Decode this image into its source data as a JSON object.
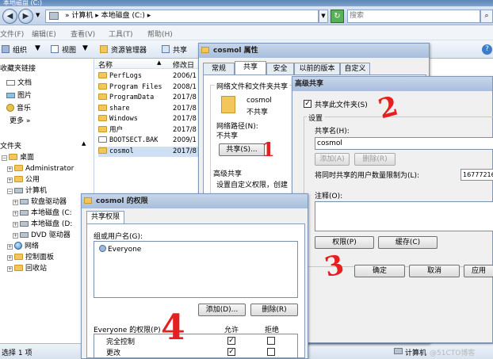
{
  "window": {
    "title": "本地磁盘 (C:)",
    "address_path": [
      "计算机",
      "本地磁盘 (C:)"
    ],
    "search_placeholder": "搜索"
  },
  "menu": [
    "文件(F)",
    "编辑(E)",
    "查看(V)",
    "工具(T)",
    "帮助(H)"
  ],
  "toolbar": {
    "organize": "组织",
    "views": "视图",
    "explorer": "资源管理器",
    "share": "共享"
  },
  "nav_pane": {
    "favorites_header": "收藏夹链接",
    "favorites": [
      "文档",
      "图片",
      "音乐",
      "更多 »"
    ],
    "folders_header": "文件夹",
    "tree": [
      {
        "label": "桌面",
        "indent": 0
      },
      {
        "label": "Administrator",
        "indent": 1
      },
      {
        "label": "公用",
        "indent": 1
      },
      {
        "label": "计算机",
        "indent": 1
      },
      {
        "label": "软盘驱动器",
        "indent": 2
      },
      {
        "label": "本地磁盘 (C:",
        "indent": 2
      },
      {
        "label": "本地磁盘 (D:",
        "indent": 2
      },
      {
        "label": "DVD 驱动器",
        "indent": 2
      },
      {
        "label": "网络",
        "indent": 1
      },
      {
        "label": "控制面板",
        "indent": 1
      },
      {
        "label": "回收站",
        "indent": 1
      }
    ]
  },
  "file_list": {
    "col_name": "名称",
    "col_date": "修改日",
    "files": [
      {
        "name": "PerfLogs",
        "date": "2006/1",
        "type": "folder"
      },
      {
        "name": "Program Files",
        "date": "2008/1",
        "type": "folder"
      },
      {
        "name": "ProgramData",
        "date": "2017/8",
        "type": "folder"
      },
      {
        "name": "share",
        "date": "2017/8",
        "type": "folder"
      },
      {
        "name": "Windows",
        "date": "2017/8",
        "type": "folder"
      },
      {
        "name": "用户",
        "date": "2017/8",
        "type": "folder"
      },
      {
        "name": "BOOTSECT.BAK",
        "date": "2009/1",
        "type": "file"
      },
      {
        "name": "cosmol",
        "date": "2017/8",
        "type": "folder"
      }
    ]
  },
  "status_bar": {
    "selection": "选择 1 项",
    "location": "计算机",
    "watermark": "@51CTO博客"
  },
  "properties_dialog": {
    "title": "cosmol 属性",
    "tabs": [
      "常规",
      "共享",
      "安全",
      "以前的版本",
      "自定义"
    ],
    "section1_label": "网络文件和文件夹共享",
    "folder_name": "cosmol",
    "share_state": "不共享",
    "network_path_label": "网络路径(N):",
    "network_path_value": "不共享",
    "share_button": "共享(S)...",
    "section2_label": "高级共享",
    "section2_text": "设置自定义权限，创建"
  },
  "advanced_dialog": {
    "title": "高级共享",
    "share_checkbox_label": "共享此文件夹(S)",
    "share_checked": true,
    "settings_label": "设置",
    "share_name_label": "共享名(H):",
    "share_name_value": "cosmol",
    "add_button": "添加(A)",
    "remove_button": "删除(R)",
    "user_limit_label": "将同时共享的用户数量限制为(L):",
    "user_limit_value": "16777216",
    "comment_label": "注释(O):",
    "permissions_button": "权限(P)",
    "caching_button": "缓存(C)",
    "ok_button": "确定",
    "cancel_button": "取消",
    "apply_button": "应用"
  },
  "permissions_dialog": {
    "title": "cosmol 的权限",
    "tab": "共享权限",
    "group_label": "组或用户名(G):",
    "users": [
      "Everyone"
    ],
    "add_button": "添加(D)...",
    "remove_button": "删除(R)",
    "perm_for_label": "Everyone 的权限(P)",
    "allow_label": "允许",
    "deny_label": "拒绝",
    "permissions": [
      {
        "name": "完全控制",
        "allow": true,
        "deny": false
      },
      {
        "name": "更改",
        "allow": true,
        "deny": false
      }
    ]
  },
  "annotations": [
    "1",
    "2",
    "3",
    "4"
  ]
}
